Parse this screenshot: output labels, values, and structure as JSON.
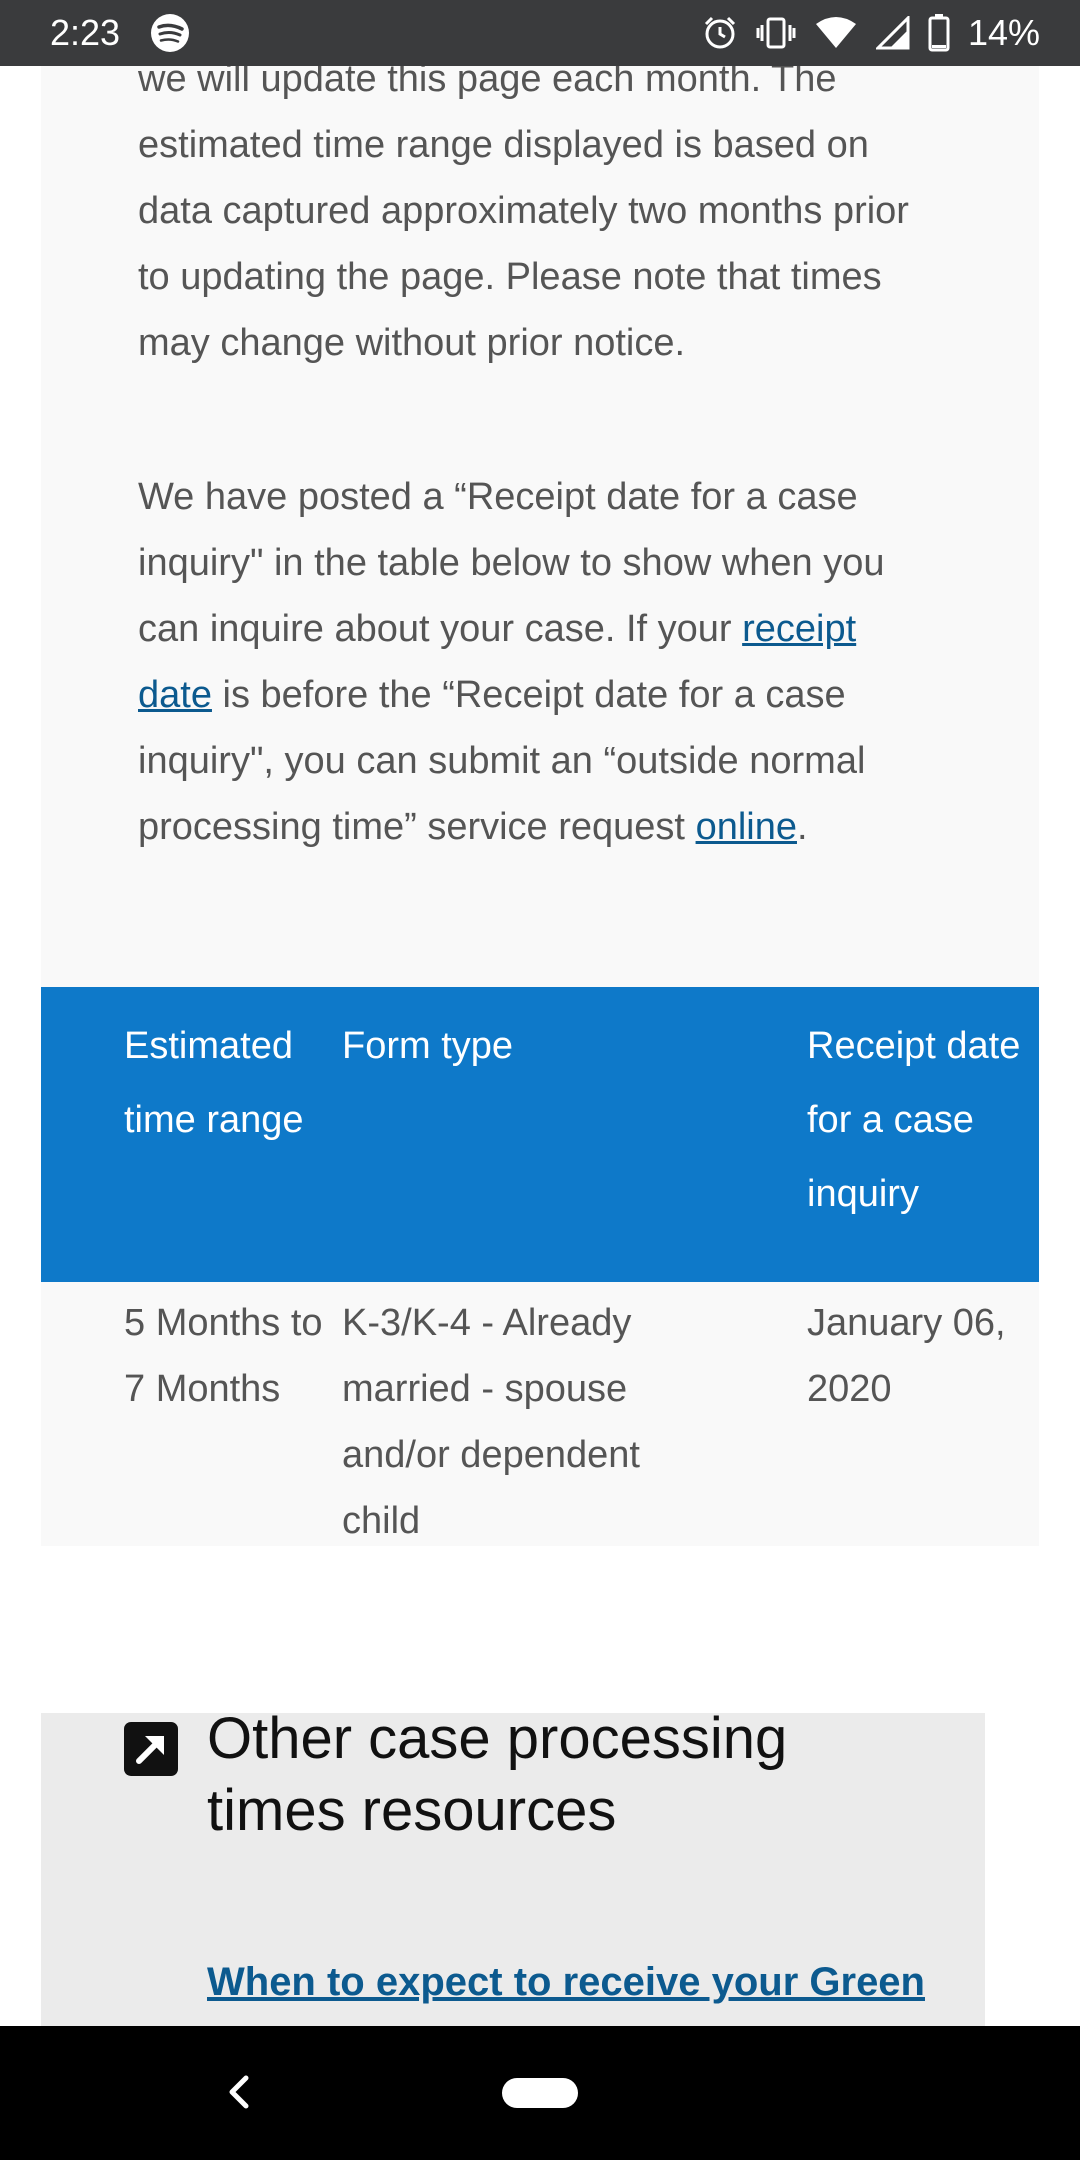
{
  "status_bar": {
    "time": "2:23",
    "battery_percent": "14%",
    "icons": [
      "spotify-icon",
      "alarm-icon",
      "vibrate-icon",
      "wifi-icon",
      "signal-icon",
      "battery-icon"
    ]
  },
  "intro": {
    "para1": "we will update this page each month. The estimated time range displayed is based on data captured approximately two months prior to updating the page. Please note that times may change without prior notice.",
    "para2_a": "We have posted a “Receipt date for a case inquiry\" in the table below to show when you can inquire about your case. If your ",
    "para2_link1": "receipt date",
    "para2_b": " is before the “Receipt date for a case inquiry\", you can submit an “outside normal processing time” service request ",
    "para2_link2": "online",
    "para2_c": "."
  },
  "table": {
    "headers": [
      "Estimated time range",
      "Form type",
      "Receipt date for a case inquiry"
    ],
    "rows": [
      [
        "5 Months to 7 Months",
        "K-3/K-4 - Already married - spouse and/or dependent child",
        "January 06, 2020"
      ]
    ]
  },
  "resources": {
    "title": "Other case processing times resources",
    "link": "When to expect to receive your Green Card"
  },
  "colors": {
    "status_bar": "#3a3b3d",
    "table_header": "#0e79c9",
    "link": "#0c5a8f",
    "panel": "#f9f9f9",
    "resources_bg": "#ebebeb"
  }
}
